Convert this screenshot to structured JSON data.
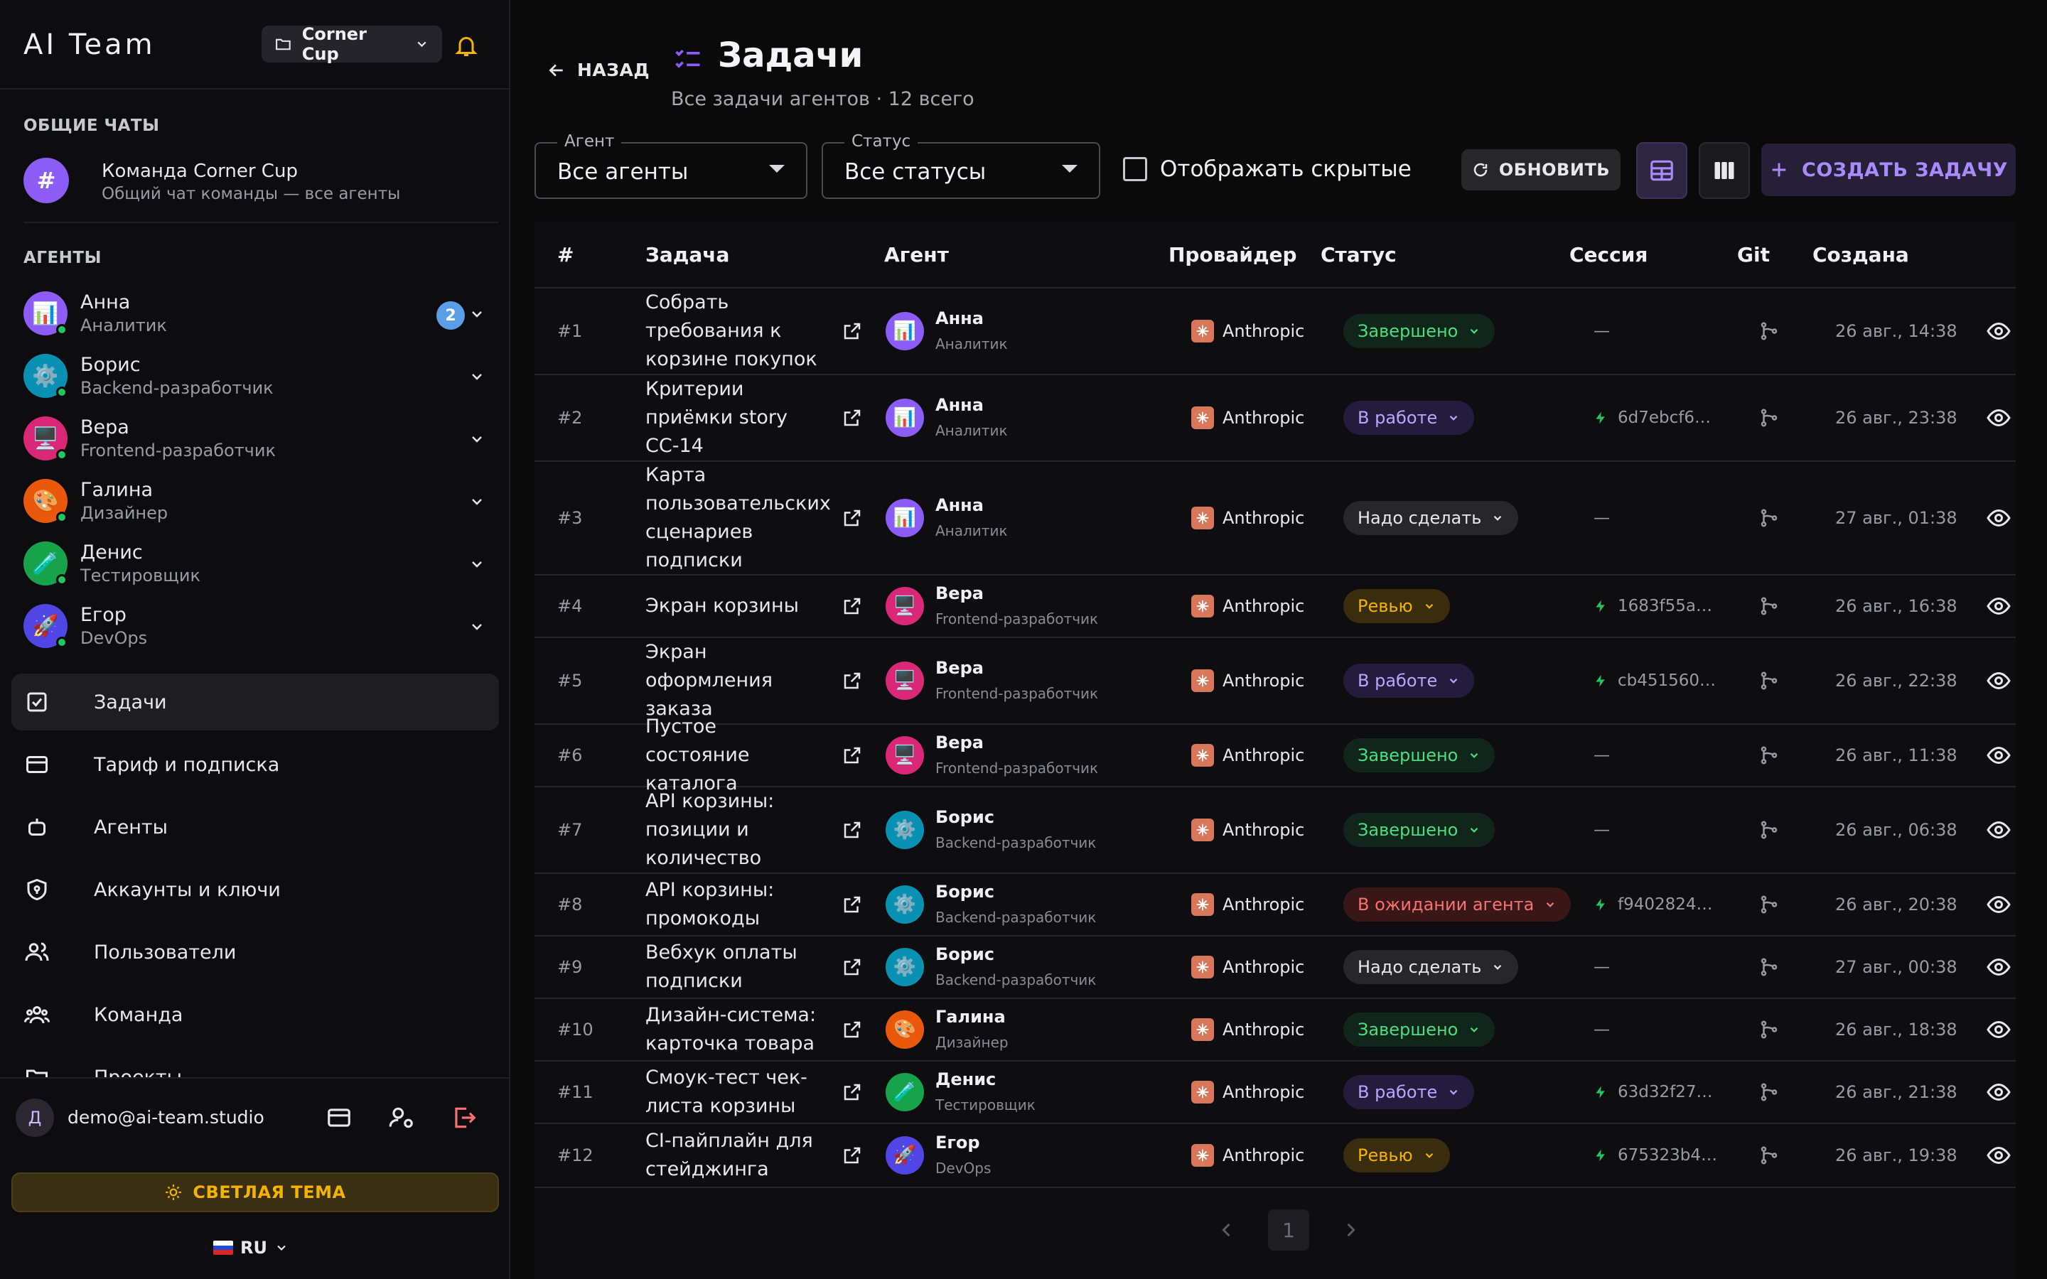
{
  "app": {
    "title": "AI Team"
  },
  "project_selector": {
    "value": "Corner Cup"
  },
  "sidebar": {
    "chats_title": "ОБЩИЕ ЧАТЫ",
    "chat": {
      "avatar": "#",
      "name": "Команда Corner Cup",
      "desc": "Общий чат команды — все агенты"
    },
    "agents_title": "АГЕНТЫ",
    "agents": [
      {
        "name": "Анна",
        "role": "Аналитик",
        "icon": "📊",
        "color": "#8b5cf6",
        "badge": "2"
      },
      {
        "name": "Борис",
        "role": "Backend-разработчик",
        "icon": "⚙️",
        "color": "#0891b2"
      },
      {
        "name": "Вера",
        "role": "Frontend-разработчик",
        "icon": "🖥️",
        "color": "#db2777"
      },
      {
        "name": "Галина",
        "role": "Дизайнер",
        "icon": "🎨",
        "color": "#ea580c"
      },
      {
        "name": "Денис",
        "role": "Тестировщик",
        "icon": "🧪",
        "color": "#16a34a"
      },
      {
        "name": "Егор",
        "role": "DevOps",
        "icon": "🚀",
        "color": "#4f46e5"
      }
    ],
    "nav": [
      {
        "label": "Задачи",
        "icon": "task-check-icon",
        "active": true
      },
      {
        "label": "Тариф и подписка",
        "icon": "credit-card-icon"
      },
      {
        "label": "Агенты",
        "icon": "robot-icon"
      },
      {
        "label": "Аккаунты и ключи",
        "icon": "shield-key-icon"
      },
      {
        "label": "Пользователи",
        "icon": "users-icon"
      },
      {
        "label": "Команда",
        "icon": "team-icon"
      },
      {
        "label": "Проекты",
        "icon": "folder-icon"
      }
    ],
    "user": {
      "initial": "Д",
      "email": "demo@ai-team.studio"
    },
    "theme_button": "СВЕТЛАЯ ТЕМА",
    "language": "RU"
  },
  "main": {
    "back_label": "НАЗАД",
    "title": "Задачи",
    "subtitle": "Все задачи агентов · 12 всего",
    "filters": {
      "agent_legend": "Агент",
      "agent_value": "Все агенты",
      "status_legend": "Статус",
      "status_value": "Все статусы",
      "show_hidden": "Отображать скрытые"
    },
    "refresh_label": "ОБНОВИТЬ",
    "create_label": "СОЗДАТЬ ЗАДАЧУ",
    "columns": [
      "#",
      "Задача",
      "Агент",
      "Провайдер",
      "Статус",
      "Сессия",
      "Git",
      "Создана"
    ],
    "page": "1"
  },
  "colors": {
    "accent": "#8b5cf6",
    "done": "#4ade80",
    "review": "#f5b300",
    "waiting": "#f87171"
  },
  "tasks": [
    {
      "num": "#1",
      "title": "Собрать требования к корзине покупок",
      "agent": "Анна",
      "role": "Аналитик",
      "icon": "📊",
      "color": "#8b5cf6",
      "provider": "Anthropic",
      "status": "Завершено",
      "kind": "done",
      "session": "—",
      "created": "26 авг., 14:38"
    },
    {
      "num": "#2",
      "title": "Критерии приёмки story CC-14",
      "agent": "Анна",
      "role": "Аналитик",
      "icon": "📊",
      "color": "#8b5cf6",
      "provider": "Anthropic",
      "status": "В работе",
      "kind": "work",
      "session": "6d7ebcf6…",
      "created": "26 авг., 23:38"
    },
    {
      "num": "#3",
      "title": "Карта пользовательских сценариев подписки",
      "agent": "Анна",
      "role": "Аналитик",
      "icon": "📊",
      "color": "#8b5cf6",
      "provider": "Anthropic",
      "status": "Надо сделать",
      "kind": "todo",
      "session": "—",
      "created": "27 авг., 01:38"
    },
    {
      "num": "#4",
      "title": "Экран корзины",
      "agent": "Вера",
      "role": "Frontend-разработчик",
      "icon": "🖥️",
      "color": "#db2777",
      "provider": "Anthropic",
      "status": "Ревью",
      "kind": "rev",
      "session": "1683f55a…",
      "created": "26 авг., 16:38"
    },
    {
      "num": "#5",
      "title": "Экран оформления заказа",
      "agent": "Вера",
      "role": "Frontend-разработчик",
      "icon": "🖥️",
      "color": "#db2777",
      "provider": "Anthropic",
      "status": "В работе",
      "kind": "work",
      "session": "cb451560…",
      "created": "26 авг., 22:38"
    },
    {
      "num": "#6",
      "title": "Пустое состояние каталога",
      "agent": "Вера",
      "role": "Frontend-разработчик",
      "icon": "🖥️",
      "color": "#db2777",
      "provider": "Anthropic",
      "status": "Завершено",
      "kind": "done",
      "session": "—",
      "created": "26 авг., 11:38"
    },
    {
      "num": "#7",
      "title": "API корзины: позиции и количество",
      "agent": "Борис",
      "role": "Backend-разработчик",
      "icon": "⚙️",
      "color": "#0891b2",
      "provider": "Anthropic",
      "status": "Завершено",
      "kind": "done",
      "session": "—",
      "created": "26 авг., 06:38"
    },
    {
      "num": "#8",
      "title": "API корзины: промокоды",
      "agent": "Борис",
      "role": "Backend-разработчик",
      "icon": "⚙️",
      "color": "#0891b2",
      "provider": "Anthropic",
      "status": "В ожидании агента",
      "kind": "wait",
      "session": "f9402824…",
      "created": "26 авг., 20:38"
    },
    {
      "num": "#9",
      "title": "Вебхук оплаты подписки",
      "agent": "Борис",
      "role": "Backend-разработчик",
      "icon": "⚙️",
      "color": "#0891b2",
      "provider": "Anthropic",
      "status": "Надо сделать",
      "kind": "todo",
      "session": "—",
      "created": "27 авг., 00:38"
    },
    {
      "num": "#10",
      "title": "Дизайн-система: карточка товара",
      "agent": "Галина",
      "role": "Дизайнер",
      "icon": "🎨",
      "color": "#ea580c",
      "provider": "Anthropic",
      "status": "Завершено",
      "kind": "done",
      "session": "—",
      "created": "26 авг., 18:38"
    },
    {
      "num": "#11",
      "title": "Смоук-тест чек-листа корзины",
      "agent": "Денис",
      "role": "Тестировщик",
      "icon": "🧪",
      "color": "#16a34a",
      "provider": "Anthropic",
      "status": "В работе",
      "kind": "work",
      "session": "63d32f27…",
      "created": "26 авг., 21:38"
    },
    {
      "num": "#12",
      "title": "CI-пайплайн для стейджинга",
      "agent": "Егор",
      "role": "DevOps",
      "icon": "🚀",
      "color": "#4f46e5",
      "provider": "Anthropic",
      "status": "Ревью",
      "kind": "rev",
      "session": "675323b4…",
      "created": "26 авг., 19:38"
    }
  ]
}
